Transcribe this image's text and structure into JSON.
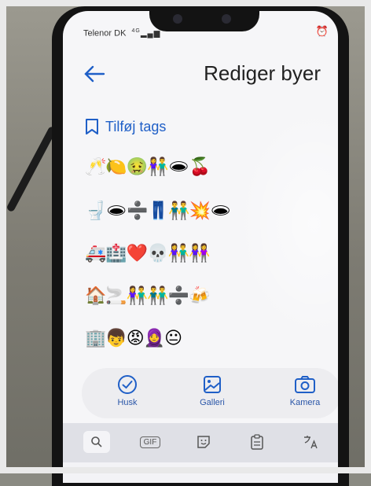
{
  "status_bar": {
    "carrier": "Telenor DK",
    "network": "4G"
  },
  "header": {
    "title": "Rediger byer"
  },
  "tags": {
    "label": "Tilføj tags"
  },
  "emoji_lines": [
    "🥂🍋🤢👫🕳🍒",
    "🚽🕳➗👖👬💥🕳",
    "🚑🏥❤️💀👫👭",
    "🏠🚬👫👬➗🍻",
    "🏢👦😡🧕😐"
  ],
  "actions": [
    {
      "label": "Husk",
      "icon": "check-circle-icon"
    },
    {
      "label": "Galleri",
      "icon": "image-icon"
    },
    {
      "label": "Kamera",
      "icon": "camera-icon"
    }
  ],
  "keyboard": {
    "gif_label": "GIF",
    "icons": [
      "search-icon",
      "gif-icon",
      "sticker-icon",
      "clipboard-icon",
      "translate-icon"
    ]
  },
  "colors": {
    "accent": "#1f5fc7"
  }
}
